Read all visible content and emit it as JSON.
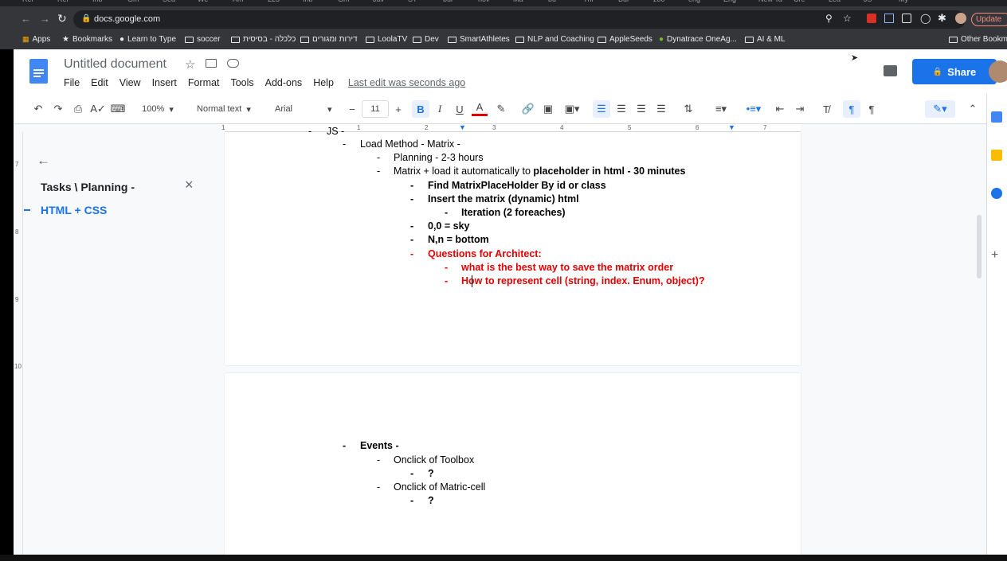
{
  "browser": {
    "tabs": [
      "Reі",
      "Reі",
      "Inb",
      "Gm",
      "Sea",
      "We",
      "Am",
      "225",
      "Inb",
      "Gm",
      "Jav",
      "ST",
      "bui",
      "nov",
      "Ma",
      "bu",
      "Thi",
      "Bui",
      "zoo",
      "eng",
      "Eng",
      "New Ta",
      "Cre",
      "Lea",
      "JS",
      "My"
    ],
    "url": "docs.google.com",
    "update_label": "Update",
    "bookmarks": [
      {
        "label": "Apps",
        "icon": "apps-grid-icon"
      },
      {
        "label": "Bookmarks",
        "icon": "star-icon"
      },
      {
        "label": "Learn to Type",
        "icon": "globe-icon"
      },
      {
        "label": "soccer",
        "icon": "folder-icon"
      },
      {
        "label": "כלכלה - בסיסית",
        "icon": "folder-icon"
      },
      {
        "label": "דירות ומגורים",
        "icon": "folder-icon"
      },
      {
        "label": "LoolaTV",
        "icon": "folder-icon"
      },
      {
        "label": "Dev",
        "icon": "folder-icon"
      },
      {
        "label": "SmartAthletes",
        "icon": "folder-icon"
      },
      {
        "label": "NLP and Coaching",
        "icon": "folder-icon"
      },
      {
        "label": "AppleSeeds",
        "icon": "folder-icon"
      },
      {
        "label": "Dynatrace OneAg...",
        "icon": "dynatrace-icon"
      },
      {
        "label": "AI & ML",
        "icon": "folder-icon"
      }
    ],
    "other_bookmarks": "Other Bookma"
  },
  "doc": {
    "title": "Untitled document",
    "menu": [
      "File",
      "Edit",
      "View",
      "Insert",
      "Format",
      "Tools",
      "Add-ons",
      "Help"
    ],
    "last_edit": "Last edit was seconds ago",
    "share_label": "Share"
  },
  "toolbar": {
    "zoom": "100%",
    "style": "Normal text",
    "font": "Arial",
    "font_size": "11"
  },
  "ruler": {
    "marks": [
      "1",
      "1",
      "2",
      "3",
      "4",
      "5",
      "6",
      "7"
    ],
    "left_marks": [
      "7",
      "8",
      "9",
      "10"
    ]
  },
  "outline": {
    "title": "Tasks \\ Planning -",
    "items": [
      "HTML + CSS"
    ]
  },
  "page1": {
    "lines": [
      {
        "indent": 0,
        "text": "Load Method - Matrix -",
        "style": "normal"
      },
      {
        "indent": 1,
        "text": "Planning - 2-3 hours",
        "style": "normal"
      },
      {
        "indent": 1,
        "text": "Matrix + load it automatically to ",
        "bold_tail": "placeholder in html - 30 minutes",
        "style": "mixed"
      },
      {
        "indent": 2,
        "text": "Find MatrixPlaceHolder By id or class",
        "style": "bold"
      },
      {
        "indent": 2,
        "text": "Insert the matrix (dynamic) html",
        "style": "bold"
      },
      {
        "indent": 3,
        "text": "Iteration (2 foreaches)",
        "style": "bold"
      },
      {
        "indent": 2,
        "text": "0,0 = sky",
        "style": "bold"
      },
      {
        "indent": 2,
        "text": "N,n = bottom",
        "style": "bold"
      },
      {
        "indent": 2,
        "text": "Questions for Architect:",
        "style": "red"
      },
      {
        "indent": 3,
        "text": "what is the best way to save the matrix order",
        "style": "red"
      },
      {
        "indent": 3,
        "text": "How to represent cell (string, index. Enum, object)?",
        "style": "red"
      }
    ]
  },
  "page2": {
    "lines": [
      {
        "indent": 0,
        "text": "Events -",
        "style": "bold"
      },
      {
        "indent": 1,
        "text": "Onclick of Toolbox",
        "style": "normal"
      },
      {
        "indent": 2,
        "text": "?",
        "style": "bold"
      },
      {
        "indent": 1,
        "text": "Onclick of Matric-cell",
        "style": "normal"
      },
      {
        "indent": 2,
        "text": "?",
        "style": "bold"
      }
    ]
  },
  "colors": {
    "accent": "#1a73e8",
    "red_text": "#e20000",
    "chrome_dark": "#35363a"
  }
}
